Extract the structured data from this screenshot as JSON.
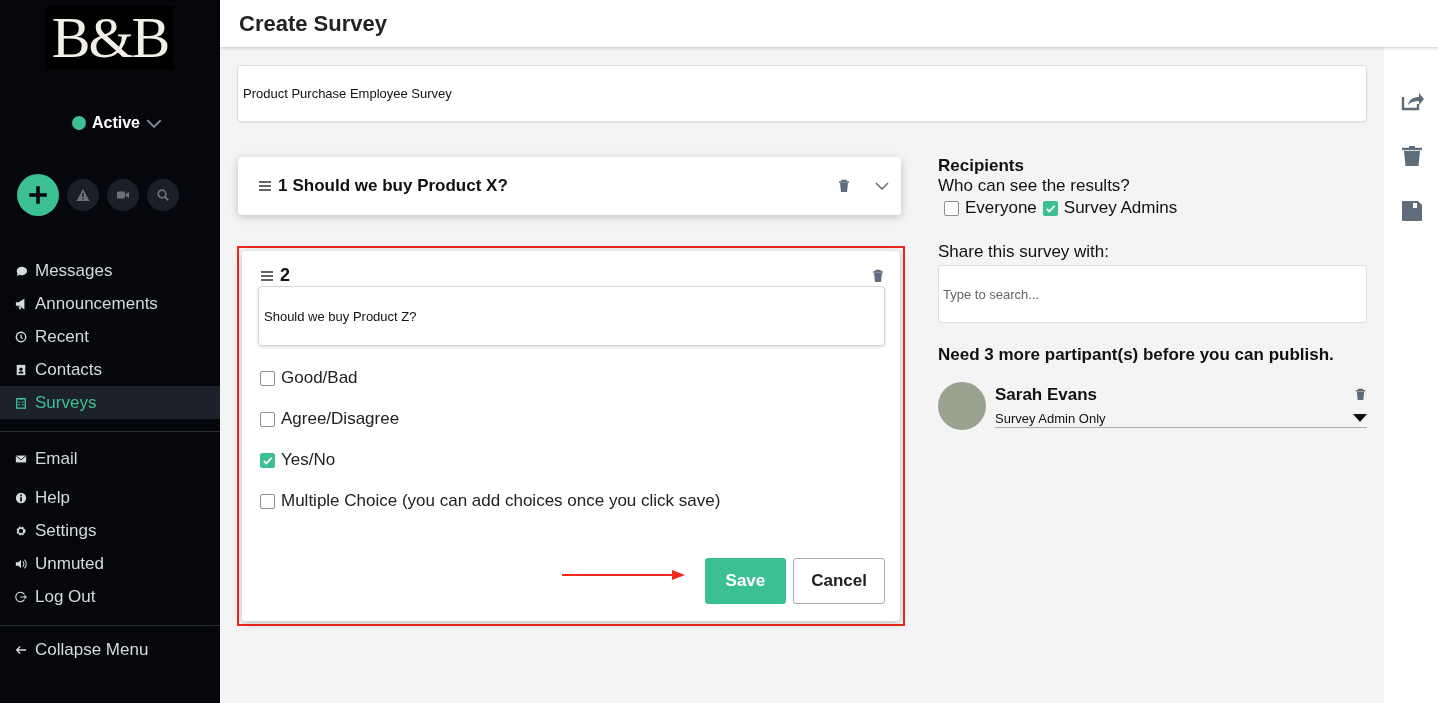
{
  "sidebar": {
    "logo": "B&B",
    "status": {
      "label": "Active"
    },
    "nav_sections": [
      {
        "items": [
          {
            "label": "Messages",
            "selected": false
          },
          {
            "label": "Announcements",
            "selected": false
          },
          {
            "label": "Recent",
            "selected": false
          },
          {
            "label": "Contacts",
            "selected": false
          },
          {
            "label": "Surveys",
            "selected": true
          }
        ]
      },
      {
        "items": [
          {
            "label": "Email",
            "selected": false
          }
        ]
      },
      {
        "items": [
          {
            "label": "Help",
            "selected": false
          },
          {
            "label": "Settings",
            "selected": false
          },
          {
            "label": "Unmuted",
            "selected": false
          },
          {
            "label": "Log Out",
            "selected": false
          }
        ]
      }
    ],
    "collapse": {
      "label": "Collapse Menu"
    }
  },
  "header": {
    "title": "Create Survey"
  },
  "survey_name": {
    "value": "Product Purchase Employee Survey"
  },
  "questions": [
    {
      "kind": "collapsed",
      "number": "1",
      "text": "Should we buy Product X?",
      "highlighted": false
    },
    {
      "kind": "editing",
      "number": "2",
      "text": "Should we buy Product Z?",
      "highlighted": true,
      "answer_types": [
        {
          "label": "Good/Bad",
          "checked": false
        },
        {
          "label": "Agree/Disagree",
          "checked": false
        },
        {
          "label": "Yes/No",
          "checked": true
        },
        {
          "label": "Multiple Choice (you can add choices once you click save)",
          "checked": false
        }
      ],
      "buttons": [
        {
          "label": "Save",
          "kind": "primary"
        },
        {
          "label": "Cancel",
          "kind": "secondary"
        }
      ]
    }
  ],
  "recipients": {
    "title": "Recipients",
    "question": "Who can see the results?",
    "options": [
      {
        "label": "Everyone",
        "checked": false
      },
      {
        "label": "Survey Admins",
        "checked": true
      }
    ],
    "share_label": "Share this survey with:",
    "search": {
      "placeholder": "Type to search..."
    },
    "notice": "Need 3 more partipant(s) before you can publish.",
    "participants": [
      {
        "name": "Sarah Evans",
        "role": "Survey Admin Only"
      }
    ]
  }
}
